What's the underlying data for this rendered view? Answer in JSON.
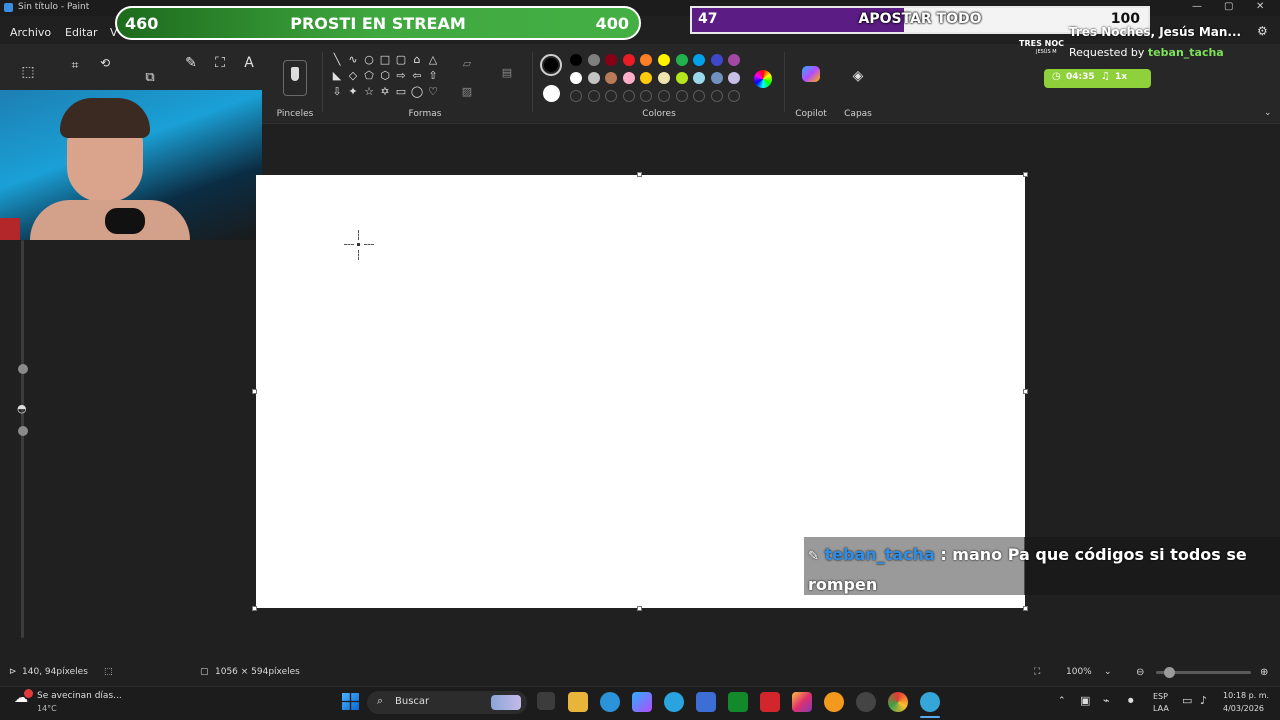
{
  "window": {
    "title": "Sin título - Paint",
    "minimize": "—",
    "maximize": "▢",
    "close": "✕"
  },
  "menu": {
    "file": "Archivo",
    "edit": "Editar",
    "view": "V"
  },
  "ribbon": {
    "brushes_label": "Pinceles",
    "shapes_label": "Formas",
    "colors_label": "Colores",
    "copilot_label": "Copilot",
    "layers_label": "Capas",
    "text_tool": "A",
    "shape_glyphs": [
      "╲",
      "∿",
      "○",
      "□",
      "▢",
      "⌂",
      "△",
      "◣",
      "◇",
      "⬠",
      "⬡",
      "⇨",
      "⇦",
      "⇧",
      "⇩",
      "✦",
      "☆",
      "✡",
      "▭",
      "◯",
      "♡"
    ],
    "palette_row1": [
      "#000000",
      "#7f7f7f",
      "#880015",
      "#ed1c24",
      "#ff7f27",
      "#fff200",
      "#22b14c",
      "#00a2e8",
      "#3f48cc",
      "#a349a4"
    ],
    "palette_row2": [
      "#ffffff",
      "#c3c3c3",
      "#b97a57",
      "#ffaec9",
      "#ffc90e",
      "#efe4b0",
      "#b5e61d",
      "#99d9ea",
      "#7092be",
      "#c8bfe7"
    ],
    "primary_color": "#000000",
    "secondary_color": "#ffffff"
  },
  "stream": {
    "goal": {
      "left": "460",
      "title": "PROSTI EN STREAM",
      "right": "400"
    },
    "bet": {
      "left": "47",
      "title": "APOSTAR TODO",
      "right": "100"
    },
    "song": {
      "title": "Tres Noches, Jesús Man...",
      "requested_prefix": "Requested by ",
      "requester": "teban_tacha",
      "time": "04:35",
      "speed": "1x",
      "album_art_line1": "TRES NOC",
      "album_art_line2": "JESÚS M"
    },
    "chat": {
      "user": "teban_tacha",
      "separator": " : ",
      "message": "mano Pa que códigos si todos se rompen"
    }
  },
  "status": {
    "position": "140, 94píxeles",
    "canvas_size": "1056 × 594píxeles",
    "zoom": "100%"
  },
  "taskbar": {
    "weather_text": "Se avecinan días...",
    "weather_temp": "14°C",
    "search": "Buscar",
    "lang_line1": "ESP",
    "lang_line2": "LAA",
    "time": "10:18 p. m.",
    "date": "4/03/2026"
  }
}
